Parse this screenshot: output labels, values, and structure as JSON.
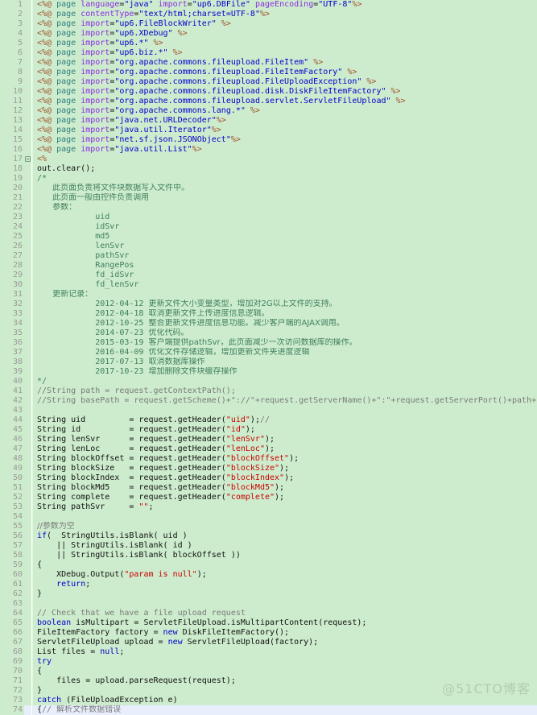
{
  "editor": {
    "background_color": "#cdeccd",
    "gutter_color": "#9a9a9a",
    "current_line_color": "#e8eefc",
    "current_line_number": 74,
    "first_line": 1,
    "last_line": 74,
    "fold_markers": [
      17
    ]
  },
  "watermark": {
    "text": "@51CTO博客"
  },
  "lines": [
    {
      "n": 1,
      "tokens": [
        {
          "c": "tg",
          "t": "<%@"
        },
        {
          "c": "dir",
          "t": " page "
        },
        {
          "c": "att",
          "t": "language"
        },
        {
          "c": "pln",
          "t": "="
        },
        {
          "c": "str",
          "t": "\"java\""
        },
        {
          "c": "att",
          "t": " import"
        },
        {
          "c": "pln",
          "t": "="
        },
        {
          "c": "str",
          "t": "\"up6.DBFile\""
        },
        {
          "c": "att",
          "t": " pageEncoding"
        },
        {
          "c": "pln",
          "t": "="
        },
        {
          "c": "str",
          "t": "\"UTF-8\""
        },
        {
          "c": "tg",
          "t": "%>"
        }
      ]
    },
    {
      "n": 2,
      "tokens": [
        {
          "c": "tg",
          "t": "<%@"
        },
        {
          "c": "dir",
          "t": " page "
        },
        {
          "c": "att",
          "t": "contentType"
        },
        {
          "c": "pln",
          "t": "="
        },
        {
          "c": "str",
          "t": "\"text/html;charset=UTF-8\""
        },
        {
          "c": "tg",
          "t": "%>"
        }
      ]
    },
    {
      "n": 3,
      "tokens": [
        {
          "c": "tg",
          "t": "<%@"
        },
        {
          "c": "dir",
          "t": " page "
        },
        {
          "c": "att",
          "t": "import"
        },
        {
          "c": "pln",
          "t": "="
        },
        {
          "c": "str",
          "t": "\"up6.FileBlockWriter\""
        },
        {
          "c": "tg",
          "t": " %>"
        }
      ]
    },
    {
      "n": 4,
      "tokens": [
        {
          "c": "tg",
          "t": "<%@"
        },
        {
          "c": "dir",
          "t": " page "
        },
        {
          "c": "att",
          "t": "import"
        },
        {
          "c": "pln",
          "t": "="
        },
        {
          "c": "str",
          "t": "\"up6.XDebug\""
        },
        {
          "c": "tg",
          "t": " %>"
        }
      ]
    },
    {
      "n": 5,
      "tokens": [
        {
          "c": "tg",
          "t": "<%@"
        },
        {
          "c": "dir",
          "t": " page "
        },
        {
          "c": "att",
          "t": "import"
        },
        {
          "c": "pln",
          "t": "="
        },
        {
          "c": "str",
          "t": "\"up6.*\""
        },
        {
          "c": "tg",
          "t": " %>"
        }
      ]
    },
    {
      "n": 6,
      "tokens": [
        {
          "c": "tg",
          "t": "<%@"
        },
        {
          "c": "dir",
          "t": " page "
        },
        {
          "c": "att",
          "t": "import"
        },
        {
          "c": "pln",
          "t": "="
        },
        {
          "c": "str",
          "t": "\"up6.biz.*\""
        },
        {
          "c": "tg",
          "t": " %>"
        }
      ]
    },
    {
      "n": 7,
      "tokens": [
        {
          "c": "tg",
          "t": "<%@"
        },
        {
          "c": "dir",
          "t": " page "
        },
        {
          "c": "att",
          "t": "import"
        },
        {
          "c": "pln",
          "t": "="
        },
        {
          "c": "str",
          "t": "\"org.apache.commons.fileupload.FileItem\""
        },
        {
          "c": "tg",
          "t": " %>"
        }
      ]
    },
    {
      "n": 8,
      "tokens": [
        {
          "c": "tg",
          "t": "<%@"
        },
        {
          "c": "dir",
          "t": " page "
        },
        {
          "c": "att",
          "t": "import"
        },
        {
          "c": "pln",
          "t": "="
        },
        {
          "c": "str",
          "t": "\"org.apache.commons.fileupload.FileItemFactory\""
        },
        {
          "c": "tg",
          "t": " %>"
        }
      ]
    },
    {
      "n": 9,
      "tokens": [
        {
          "c": "tg",
          "t": "<%@"
        },
        {
          "c": "dir",
          "t": " page "
        },
        {
          "c": "att",
          "t": "import"
        },
        {
          "c": "pln",
          "t": "="
        },
        {
          "c": "str",
          "t": "\"org.apache.commons.fileupload.FileUploadException\""
        },
        {
          "c": "tg",
          "t": " %>"
        }
      ]
    },
    {
      "n": 10,
      "tokens": [
        {
          "c": "tg",
          "t": "<%@"
        },
        {
          "c": "dir",
          "t": " page "
        },
        {
          "c": "att",
          "t": "import"
        },
        {
          "c": "pln",
          "t": "="
        },
        {
          "c": "str",
          "t": "\"org.apache.commons.fileupload.disk.DiskFileItemFactory\""
        },
        {
          "c": "tg",
          "t": " %>"
        }
      ]
    },
    {
      "n": 11,
      "tokens": [
        {
          "c": "tg",
          "t": "<%@"
        },
        {
          "c": "dir",
          "t": " page "
        },
        {
          "c": "att",
          "t": "import"
        },
        {
          "c": "pln",
          "t": "="
        },
        {
          "c": "str",
          "t": "\"org.apache.commons.fileupload.servlet.ServletFileUpload\""
        },
        {
          "c": "tg",
          "t": " %>"
        }
      ]
    },
    {
      "n": 12,
      "tokens": [
        {
          "c": "tg",
          "t": "<%@"
        },
        {
          "c": "dir",
          "t": " page "
        },
        {
          "c": "att",
          "t": "import"
        },
        {
          "c": "pln",
          "t": "="
        },
        {
          "c": "str",
          "t": "\"org.apache.commons.lang.*\""
        },
        {
          "c": "tg",
          "t": " %>"
        }
      ]
    },
    {
      "n": 13,
      "tokens": [
        {
          "c": "tg",
          "t": "<%@"
        },
        {
          "c": "dir",
          "t": " page "
        },
        {
          "c": "att",
          "t": "import"
        },
        {
          "c": "pln",
          "t": "="
        },
        {
          "c": "str",
          "t": "\"java.net.URLDecoder\""
        },
        {
          "c": "tg",
          "t": "%>"
        }
      ]
    },
    {
      "n": 14,
      "tokens": [
        {
          "c": "tg",
          "t": "<%@"
        },
        {
          "c": "dir",
          "t": " page "
        },
        {
          "c": "att",
          "t": "import"
        },
        {
          "c": "pln",
          "t": "="
        },
        {
          "c": "str",
          "t": "\"java.util.Iterator\""
        },
        {
          "c": "tg",
          "t": "%>"
        }
      ]
    },
    {
      "n": 15,
      "tokens": [
        {
          "c": "tg",
          "t": "<%@"
        },
        {
          "c": "dir",
          "t": " page "
        },
        {
          "c": "att",
          "t": "import"
        },
        {
          "c": "pln",
          "t": "="
        },
        {
          "c": "str",
          "t": "\"net.sf.json.JSONObject\""
        },
        {
          "c": "tg",
          "t": "%>"
        }
      ]
    },
    {
      "n": 16,
      "tokens": [
        {
          "c": "tg",
          "t": "<%@"
        },
        {
          "c": "dir",
          "t": " page "
        },
        {
          "c": "att",
          "t": "import"
        },
        {
          "c": "pln",
          "t": "="
        },
        {
          "c": "str",
          "t": "\"java.util.List\""
        },
        {
          "c": "tg",
          "t": "%>"
        }
      ]
    },
    {
      "n": 17,
      "fold": true,
      "tokens": [
        {
          "c": "tg",
          "t": "<%"
        }
      ]
    },
    {
      "n": 18,
      "tokens": [
        {
          "c": "pln",
          "t": "out.clear();"
        }
      ]
    },
    {
      "n": 19,
      "tokens": [
        {
          "c": "cmt",
          "t": "/*"
        }
      ]
    },
    {
      "n": 20,
      "tokens": [
        {
          "c": "cmt cn",
          "t": "      此页面负责将文件块数据写入文件中。"
        }
      ]
    },
    {
      "n": 21,
      "tokens": [
        {
          "c": "cmt cn",
          "t": "      此页面一般由控件负责调用"
        }
      ]
    },
    {
      "n": 22,
      "tokens": [
        {
          "c": "cmt cn",
          "t": "      参数："
        }
      ]
    },
    {
      "n": 23,
      "tokens": [
        {
          "c": "cmt",
          "t": "            uid"
        }
      ]
    },
    {
      "n": 24,
      "tokens": [
        {
          "c": "cmt",
          "t": "            idSvr"
        }
      ]
    },
    {
      "n": 25,
      "tokens": [
        {
          "c": "cmt",
          "t": "            md5"
        }
      ]
    },
    {
      "n": 26,
      "tokens": [
        {
          "c": "cmt",
          "t": "            lenSvr"
        }
      ]
    },
    {
      "n": 27,
      "tokens": [
        {
          "c": "cmt",
          "t": "            pathSvr"
        }
      ]
    },
    {
      "n": 28,
      "tokens": [
        {
          "c": "cmt",
          "t": "            RangePos"
        }
      ]
    },
    {
      "n": 29,
      "tokens": [
        {
          "c": "cmt",
          "t": "            fd_idSvr"
        }
      ]
    },
    {
      "n": 30,
      "tokens": [
        {
          "c": "cmt",
          "t": "            fd_lenSvr"
        }
      ]
    },
    {
      "n": 31,
      "tokens": [
        {
          "c": "cmt cn",
          "t": "      更新记录："
        }
      ]
    },
    {
      "n": 32,
      "tokens": [
        {
          "c": "cmt",
          "t": "            2012-04-12 "
        },
        {
          "c": "cmt cn",
          "t": "更新文件大小变量类型，增加对2G以上文件的支持。"
        }
      ]
    },
    {
      "n": 33,
      "tokens": [
        {
          "c": "cmt",
          "t": "            2012-04-18 "
        },
        {
          "c": "cmt cn",
          "t": "取消更新文件上传进度信息逻辑。"
        }
      ]
    },
    {
      "n": 34,
      "tokens": [
        {
          "c": "cmt",
          "t": "            2012-10-25 "
        },
        {
          "c": "cmt cn",
          "t": "整合更新文件进度信息功能。减少客户端的AJAX调用。"
        }
      ]
    },
    {
      "n": 35,
      "tokens": [
        {
          "c": "cmt",
          "t": "            2014-07-23 "
        },
        {
          "c": "cmt cn",
          "t": "优化代码。"
        }
      ]
    },
    {
      "n": 36,
      "tokens": [
        {
          "c": "cmt",
          "t": "            2015-03-19 "
        },
        {
          "c": "cmt cn",
          "t": "客户端提供pathSvr，此页面减少一次访问数据库的操作。"
        }
      ]
    },
    {
      "n": 37,
      "tokens": [
        {
          "c": "cmt",
          "t": "            2016-04-09 "
        },
        {
          "c": "cmt cn",
          "t": "优化文件存储逻辑，增加更新文件夹进度逻辑"
        }
      ]
    },
    {
      "n": 38,
      "tokens": [
        {
          "c": "cmt",
          "t": "            2017-07-13 "
        },
        {
          "c": "cmt cn",
          "t": "取消数据库操作"
        }
      ]
    },
    {
      "n": 39,
      "tokens": [
        {
          "c": "cmt",
          "t": "            2017-10-23 "
        },
        {
          "c": "cmt cn",
          "t": "增加删除文件块缓存操作"
        }
      ]
    },
    {
      "n": 40,
      "tokens": [
        {
          "c": "cmt",
          "t": "*/"
        }
      ]
    },
    {
      "n": 41,
      "tokens": [
        {
          "c": "cmt2",
          "t": "//String path = request.getContextPath();"
        }
      ]
    },
    {
      "n": 42,
      "tokens": [
        {
          "c": "cmt2",
          "t": "//String basePath = request.getScheme()+\"://\"+request.getServerName()+\":\"+request.getServerPort()+path+\"/\";"
        }
      ]
    },
    {
      "n": 43,
      "tokens": []
    },
    {
      "n": 44,
      "tokens": [
        {
          "c": "pln",
          "t": "String uid         = request.getHeader("
        },
        {
          "c": "jstr",
          "t": "\"uid\""
        },
        {
          "c": "pln",
          "t": ");"
        },
        {
          "c": "cmt2",
          "t": "//"
        }
      ]
    },
    {
      "n": 45,
      "tokens": [
        {
          "c": "pln",
          "t": "String id          = request.getHeader("
        },
        {
          "c": "jstr",
          "t": "\"id\""
        },
        {
          "c": "pln",
          "t": ");"
        }
      ]
    },
    {
      "n": 46,
      "tokens": [
        {
          "c": "pln",
          "t": "String lenSvr      = request.getHeader("
        },
        {
          "c": "jstr",
          "t": "\"lenSvr\""
        },
        {
          "c": "pln",
          "t": ");"
        }
      ]
    },
    {
      "n": 47,
      "tokens": [
        {
          "c": "pln",
          "t": "String lenLoc      = request.getHeader("
        },
        {
          "c": "jstr",
          "t": "\"lenLoc\""
        },
        {
          "c": "pln",
          "t": ");"
        }
      ]
    },
    {
      "n": 48,
      "tokens": [
        {
          "c": "pln",
          "t": "String blockOffset = request.getHeader("
        },
        {
          "c": "jstr",
          "t": "\"blockOffset\""
        },
        {
          "c": "pln",
          "t": ");"
        }
      ]
    },
    {
      "n": 49,
      "tokens": [
        {
          "c": "pln",
          "t": "String blockSize   = request.getHeader("
        },
        {
          "c": "jstr",
          "t": "\"blockSize\""
        },
        {
          "c": "pln",
          "t": ");"
        }
      ]
    },
    {
      "n": 50,
      "tokens": [
        {
          "c": "pln",
          "t": "String blockIndex  = request.getHeader("
        },
        {
          "c": "jstr",
          "t": "\"blockIndex\""
        },
        {
          "c": "pln",
          "t": ");"
        }
      ]
    },
    {
      "n": 51,
      "tokens": [
        {
          "c": "pln",
          "t": "String blockMd5    = request.getHeader("
        },
        {
          "c": "jstr",
          "t": "\"blockMd5\""
        },
        {
          "c": "pln",
          "t": ");"
        }
      ]
    },
    {
      "n": 52,
      "tokens": [
        {
          "c": "pln",
          "t": "String complete    = request.getHeader("
        },
        {
          "c": "jstr",
          "t": "\"complete\""
        },
        {
          "c": "pln",
          "t": ");"
        }
      ]
    },
    {
      "n": 53,
      "tokens": [
        {
          "c": "pln",
          "t": "String pathSvr     = "
        },
        {
          "c": "jstr",
          "t": "\"\""
        },
        {
          "c": "pln",
          "t": ";"
        }
      ]
    },
    {
      "n": 54,
      "tokens": []
    },
    {
      "n": 55,
      "tokens": [
        {
          "c": "cmt2 cn",
          "t": "//参数为空"
        }
      ]
    },
    {
      "n": 56,
      "tokens": [
        {
          "c": "kwd",
          "t": "if"
        },
        {
          "c": "pln",
          "t": "(  StringUtils.isBlank( uid )"
        }
      ]
    },
    {
      "n": 57,
      "tokens": [
        {
          "c": "pln",
          "t": "    || StringUtils.isBlank( id )"
        }
      ]
    },
    {
      "n": 58,
      "tokens": [
        {
          "c": "pln",
          "t": "    || StringUtils.isBlank( blockOffset ))"
        }
      ]
    },
    {
      "n": 59,
      "tokens": [
        {
          "c": "pln",
          "t": "{"
        }
      ]
    },
    {
      "n": 60,
      "tokens": [
        {
          "c": "pln",
          "t": "    XDebug.Output("
        },
        {
          "c": "jstr",
          "t": "\"param is null\""
        },
        {
          "c": "pln",
          "t": ");"
        }
      ]
    },
    {
      "n": 61,
      "tokens": [
        {
          "c": "pln",
          "t": "    "
        },
        {
          "c": "kwd",
          "t": "return"
        },
        {
          "c": "pln",
          "t": ";"
        }
      ]
    },
    {
      "n": 62,
      "tokens": [
        {
          "c": "pln",
          "t": "}"
        }
      ]
    },
    {
      "n": 63,
      "tokens": []
    },
    {
      "n": 64,
      "tokens": [
        {
          "c": "cmt2",
          "t": "// Check that we have a file upload request"
        }
      ]
    },
    {
      "n": 65,
      "tokens": [
        {
          "c": "kwd",
          "t": "boolean"
        },
        {
          "c": "pln",
          "t": " isMultipart = ServletFileUpload.isMultipartContent(request);"
        }
      ]
    },
    {
      "n": 66,
      "tokens": [
        {
          "c": "pln",
          "t": "FileItemFactory factory = "
        },
        {
          "c": "kwd",
          "t": "new"
        },
        {
          "c": "pln",
          "t": " DiskFileItemFactory();"
        }
      ]
    },
    {
      "n": 67,
      "tokens": [
        {
          "c": "pln",
          "t": "ServletFileUpload upload = "
        },
        {
          "c": "kwd",
          "t": "new"
        },
        {
          "c": "pln",
          "t": " ServletFileUpload(factory);"
        }
      ]
    },
    {
      "n": 68,
      "tokens": [
        {
          "c": "pln",
          "t": "List files = "
        },
        {
          "c": "kwd",
          "t": "null"
        },
        {
          "c": "pln",
          "t": ";"
        }
      ]
    },
    {
      "n": 69,
      "tokens": [
        {
          "c": "kwd",
          "t": "try"
        }
      ]
    },
    {
      "n": 70,
      "tokens": [
        {
          "c": "pln",
          "t": "{"
        }
      ]
    },
    {
      "n": 71,
      "tokens": [
        {
          "c": "pln",
          "t": "    files = upload.parseRequest(request);"
        }
      ]
    },
    {
      "n": 72,
      "tokens": [
        {
          "c": "pln",
          "t": "}"
        }
      ]
    },
    {
      "n": 73,
      "tokens": [
        {
          "c": "kwd",
          "t": "catch"
        },
        {
          "c": "pln",
          "t": " (FileUploadException e)"
        }
      ]
    },
    {
      "n": 74,
      "current": true,
      "tokens": [
        {
          "c": "pln",
          "t": "{"
        },
        {
          "c": "cmt2",
          "t": "// "
        },
        {
          "c": "cmt2 cn",
          "t": "解析文件数据错误"
        }
      ]
    }
  ]
}
